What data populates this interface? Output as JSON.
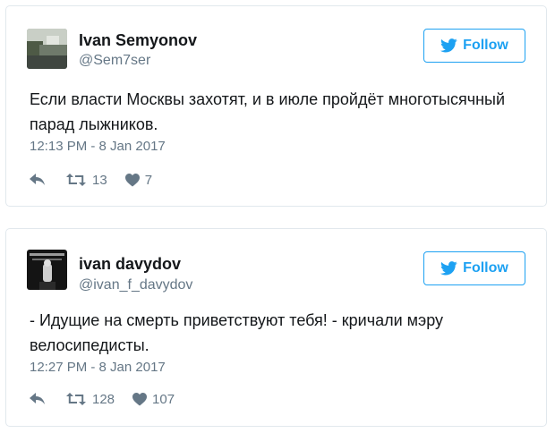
{
  "tweets": [
    {
      "author_name": "Ivan Semyonov",
      "author_handle": "@Sem7ser",
      "follow_label": "Follow",
      "text": "Если власти Москвы захотят, и в июле пройдёт многотысячный парад лыжников.",
      "timestamp": "12:13 PM - 8 Jan 2017",
      "retweets": "13",
      "likes": "7"
    },
    {
      "author_name": "ivan davydov",
      "author_handle": "@ivan_f_davydov",
      "follow_label": "Follow",
      "text": "- Идущие на смерть приветствуют тебя! - кричали мэру велосипедисты.",
      "timestamp": "12:27 PM - 8 Jan 2017",
      "retweets": "128",
      "likes": "107"
    }
  ],
  "icons": {
    "brand": "twitter-bird-icon",
    "reply": "reply-icon",
    "retweet": "retweet-icon",
    "like": "heart-icon"
  },
  "colors": {
    "accent": "#1da1f2",
    "text": "#14171a",
    "muted": "#657786",
    "border": "#e1e8ed"
  }
}
